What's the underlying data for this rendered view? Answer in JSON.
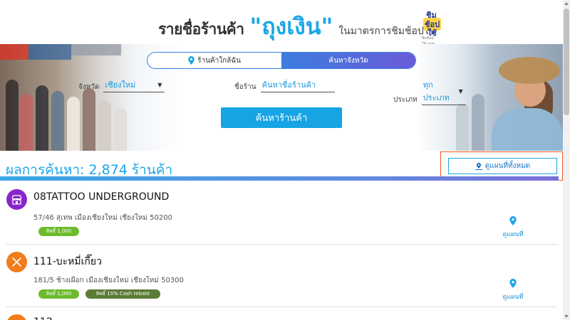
{
  "header": {
    "title_main": "รายชื่อร้านค้า",
    "title_brand": "\"ถุงเงิน\"",
    "title_tail": "ในมาตรการชิมช้อปใช้",
    "logo_lines": [
      "ชิม",
      "ช้อป",
      "ใช้",
      "ชิมช้อปใช้.com"
    ]
  },
  "search": {
    "tabs": [
      {
        "label": "ร้านค้าใกล้ฉัน",
        "icon": "location-pin-icon",
        "active": false
      },
      {
        "label": "ค้นหาจังหวัด",
        "active": true
      }
    ],
    "province_label": "จังหวัด",
    "province_value": "เชียงใหม่",
    "shop_label": "ชื่อร้าน",
    "shop_placeholder": "ค้นหาชื่อร้านค้า",
    "type_label": "ประเภท",
    "type_value": "ทุกประเภท",
    "button_label": "ค้นหาร้านค้า"
  },
  "results": {
    "title": "ผลการค้นหา: 2,874 ร้านค้า",
    "map_all_label": "ดูแผนที่ทั้งหมด",
    "map_link_label": "ดูแผนที่",
    "items": [
      {
        "name": "08TATTOO UNDERGROUND",
        "address": "57/46 สุเทพ เมืองเชียงใหม่ เชียงใหม่ 50200",
        "category_icon": "shop-icon",
        "icon_color": "#8a26c9",
        "badges": [
          {
            "label": "สิทธิ์ 1,000",
            "color": "#6dbb2c"
          }
        ]
      },
      {
        "name": "111-บะหมี่เกี๊ยว",
        "address": "181/5 ช้างเผือก เมืองเชียงใหม่ เชียงใหม่ 50300",
        "category_icon": "fork-knife-icon",
        "icon_color": "#f07c1a",
        "badges": [
          {
            "label": "สิทธิ์ 1,000",
            "color": "#6dbb2c"
          },
          {
            "label": "สิทธิ์ 15% Cash rebate",
            "color": "#5c7b37"
          }
        ]
      },
      {
        "name": "112",
        "category_icon": "fork-knife-icon",
        "icon_color": "#f07c1a"
      }
    ]
  }
}
